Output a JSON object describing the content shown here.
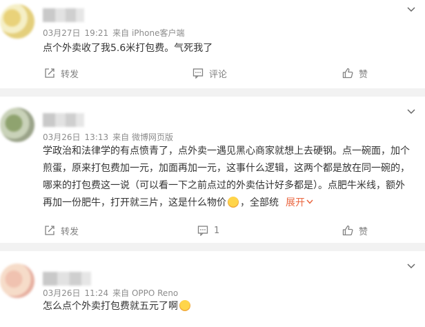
{
  "comments": [
    {
      "date": "03月27日",
      "time": "19:21",
      "source": "来自 iPhone客户端",
      "lines": [
        "点个外卖收了我5.6米打包费。气死我了"
      ],
      "repost_label": "转发",
      "comment_label": "评论",
      "like_label": "赞"
    },
    {
      "date": "03月26日",
      "time": "13:13",
      "source": "来自 微博网页版",
      "lines": [
        "学政治和法律学的有点愤青了，点外卖一遇见黑心商家就想上去硬钢。点一碗面，加个",
        "煎蛋，原来打包费加一元，加面再加一元，这事什么逻辑，这两个都是放在同一碗的，",
        "哪来的打包费这一说（可以看一下之前点过的外卖估计好多都是）。点肥牛米线，额外",
        "再加一份肥牛，打开就三片，这是什么物价",
        "，全部统"
      ],
      "expand_label": "展开",
      "repost_label": "转发",
      "comment_count": "1",
      "like_label": "赞"
    },
    {
      "date": "03月26日",
      "time": "11:24",
      "source": "来自 OPPO Reno",
      "lines": [
        "怎么点个外卖打包费就五元了啊"
      ]
    }
  ],
  "colors": {
    "accent": "#ea6640",
    "meta": "#8c8c8c",
    "text": "#333333",
    "separator": "#f2f2f2"
  },
  "icons": [
    "chevron-down-icon",
    "repost-icon",
    "comment-icon",
    "like-icon",
    "dizzy-face-emoji",
    "crying-face-emoji"
  ]
}
